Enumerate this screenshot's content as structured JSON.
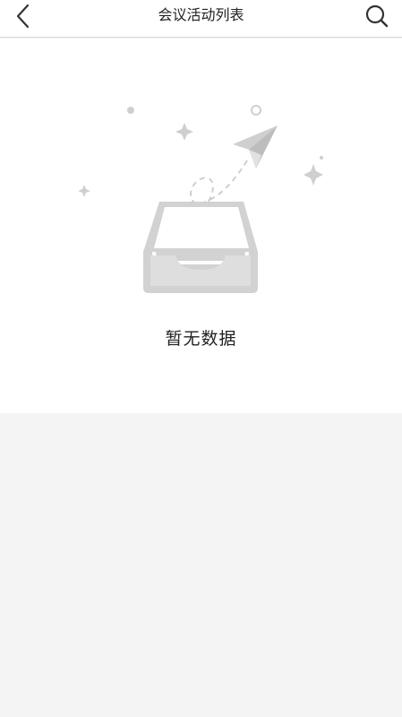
{
  "header": {
    "title": "会议活动列表",
    "back_icon": "chevron-left-icon",
    "search_icon": "search-icon"
  },
  "empty_state": {
    "message": "暂无数据",
    "illustration": "empty-inbox-paper-plane"
  },
  "colors": {
    "background": "#f4f4f4",
    "surface": "#ffffff",
    "illustration": "#cfcfcf",
    "text": "#222222"
  }
}
